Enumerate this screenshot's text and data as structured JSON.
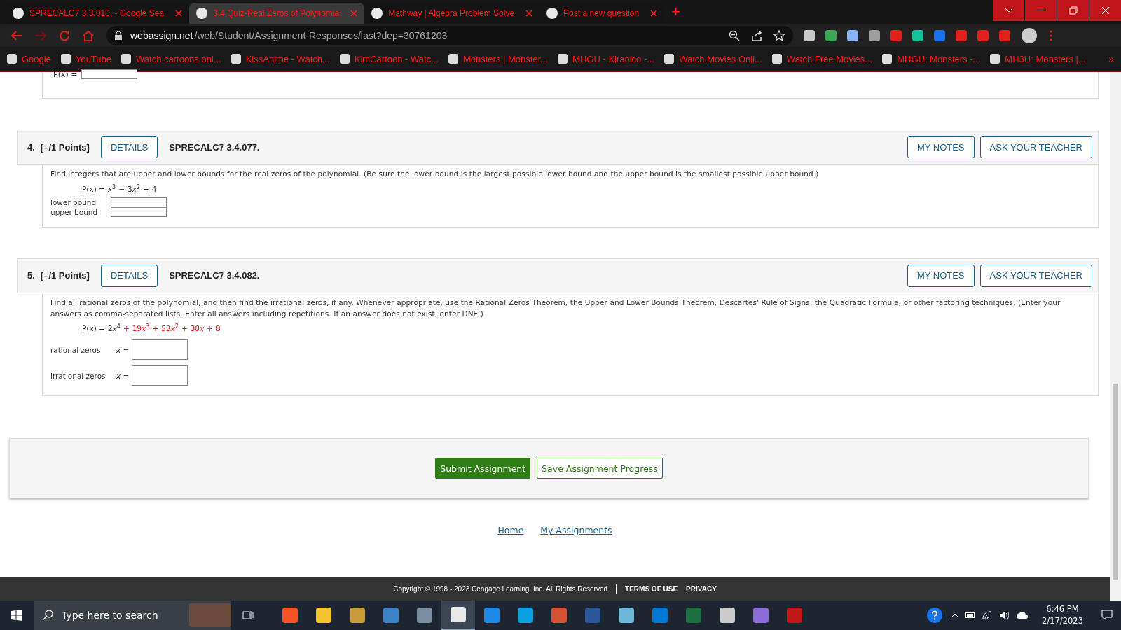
{
  "browser": {
    "tabs": [
      {
        "title": "SPRECALC7 3.3.010. - Google Sea",
        "selected": false
      },
      {
        "title": "3.4 Quiz-Real Zeros of Polynomia",
        "selected": true
      },
      {
        "title": "Mathway | Algebra Problem Solve",
        "selected": false
      },
      {
        "title": "Post a new question",
        "selected": false
      }
    ],
    "new_tab": "+",
    "address": {
      "host": "webassign.net",
      "path": "/web/Student/Assignment-Responses/last?dep=30761203"
    },
    "bookmarks": [
      "Google",
      "YouTube",
      "Watch cartoons onl...",
      "KissAnime - Watch...",
      "KimCartoon - Watc...",
      "Monsters | Monster...",
      "MHGU - Kiranico -...",
      "Watch Movies Onli...",
      "Watch Free Movies...",
      "MHGU: Monsters -...",
      "MH3U: Monsters |..."
    ],
    "bookmarks_more": "»"
  },
  "previous_fragment": {
    "label": "P(x) ="
  },
  "questions": [
    {
      "number": "4.",
      "points": "[–/1 Points]",
      "details": "DETAILS",
      "code": "SPRECALC7 3.4.077.",
      "my_notes": "MY NOTES",
      "ask": "ASK YOUR TEACHER",
      "prompt": "Find integers that are upper and lower bounds for the real zeros of the polynomial. (Be sure the lower bound is the largest possible lower bound and the upper bound is the smallest possible upper bound.)",
      "lhs": "P(x) =",
      "terms": [
        {
          "var": "x",
          "power": "3",
          "highlighted": false
        },
        {
          "sign": "−",
          "coef": "3",
          "var": "x",
          "power": "2",
          "highlighted": false
        },
        {
          "sign": "+",
          "coef": "4",
          "highlighted": false
        }
      ],
      "answers": [
        {
          "label": "lower bound",
          "kind": "small"
        },
        {
          "label": "upper bound",
          "kind": "small"
        }
      ]
    },
    {
      "number": "5.",
      "points": "[–/1 Points]",
      "details": "DETAILS",
      "code": "SPRECALC7 3.4.082.",
      "my_notes": "MY NOTES",
      "ask": "ASK YOUR TEACHER",
      "prompt": "Find all rational zeros of the polynomial, and then find the irrational zeros, if any. Whenever appropriate, use the Rational Zeros Theorem, the Upper and Lower Bounds Theorem, Descartes' Rule of Signs, the Quadratic Formula, or other factoring techniques. (Enter your answers as comma-separated lists. Enter all answers including repetitions. If an answer does not exist, enter DNE.)",
      "lhs": "P(x) =",
      "terms": [
        {
          "coef": "2",
          "var": "x",
          "power": "4",
          "highlighted": false
        },
        {
          "sign": "+",
          "coef": "19",
          "var": "x",
          "power": "3",
          "highlighted": true
        },
        {
          "sign": "+",
          "coef": "53",
          "var": "x",
          "power": "2",
          "highlighted": true
        },
        {
          "sign": "+",
          "coef": "38",
          "var": "x",
          "highlighted": true
        },
        {
          "sign": "+",
          "coef": "8",
          "highlighted": true
        }
      ],
      "answers": [
        {
          "label": "rational zeros",
          "prefix": "x =",
          "kind": "large"
        },
        {
          "label": "irrational zeros",
          "prefix": "x =",
          "kind": "large"
        }
      ]
    }
  ],
  "submit": "Submit Assignment",
  "save": "Save Assignment Progress",
  "links": [
    "Home",
    "My Assignments"
  ],
  "footer": {
    "copyright": "Copyright © 1998 - 2023 Cengage Learning, Inc. All Rights Reserved",
    "terms": "TERMS OF USE",
    "privacy": "PRIVACY"
  },
  "taskbar": {
    "search_placeholder": "Type here to search",
    "time": "6:46 PM",
    "date": "2/17/2023"
  }
}
